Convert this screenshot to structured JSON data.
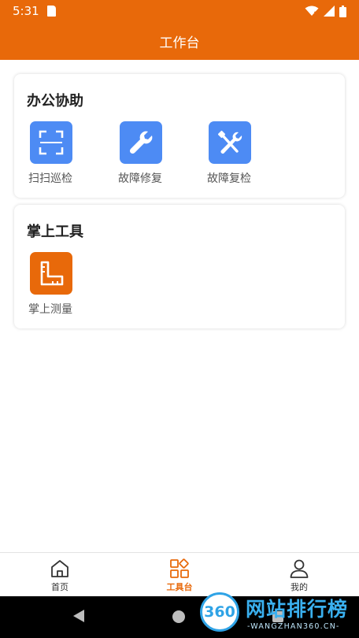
{
  "status_bar": {
    "time": "5:31",
    "icons": [
      "sd-card-icon",
      "wifi-icon",
      "signal-icon",
      "battery-icon"
    ]
  },
  "header": {
    "title": "工作台"
  },
  "office": {
    "title": "办公协助",
    "items": [
      {
        "label": "扫扫巡检",
        "icon": "scan-icon"
      },
      {
        "label": "故障修复",
        "icon": "wrench-icon"
      },
      {
        "label": "故障复检",
        "icon": "tools-icon"
      }
    ]
  },
  "tools": {
    "title": "掌上工具",
    "items": [
      {
        "label": "掌上测量",
        "icon": "ruler-icon"
      }
    ]
  },
  "bottom_nav": {
    "items": [
      {
        "label": "首页",
        "icon": "home-icon"
      },
      {
        "label": "工具台",
        "icon": "workbench-icon",
        "active": true
      },
      {
        "label": "我的",
        "icon": "profile-icon"
      }
    ]
  },
  "watermark": {
    "badge": "360",
    "name": "网站排行榜",
    "site": "-WANGZHAN360.CN-"
  },
  "colors": {
    "brand": "#e8690a",
    "icon_blue": "#4d8bf4",
    "active_tab": "#e8690a"
  }
}
